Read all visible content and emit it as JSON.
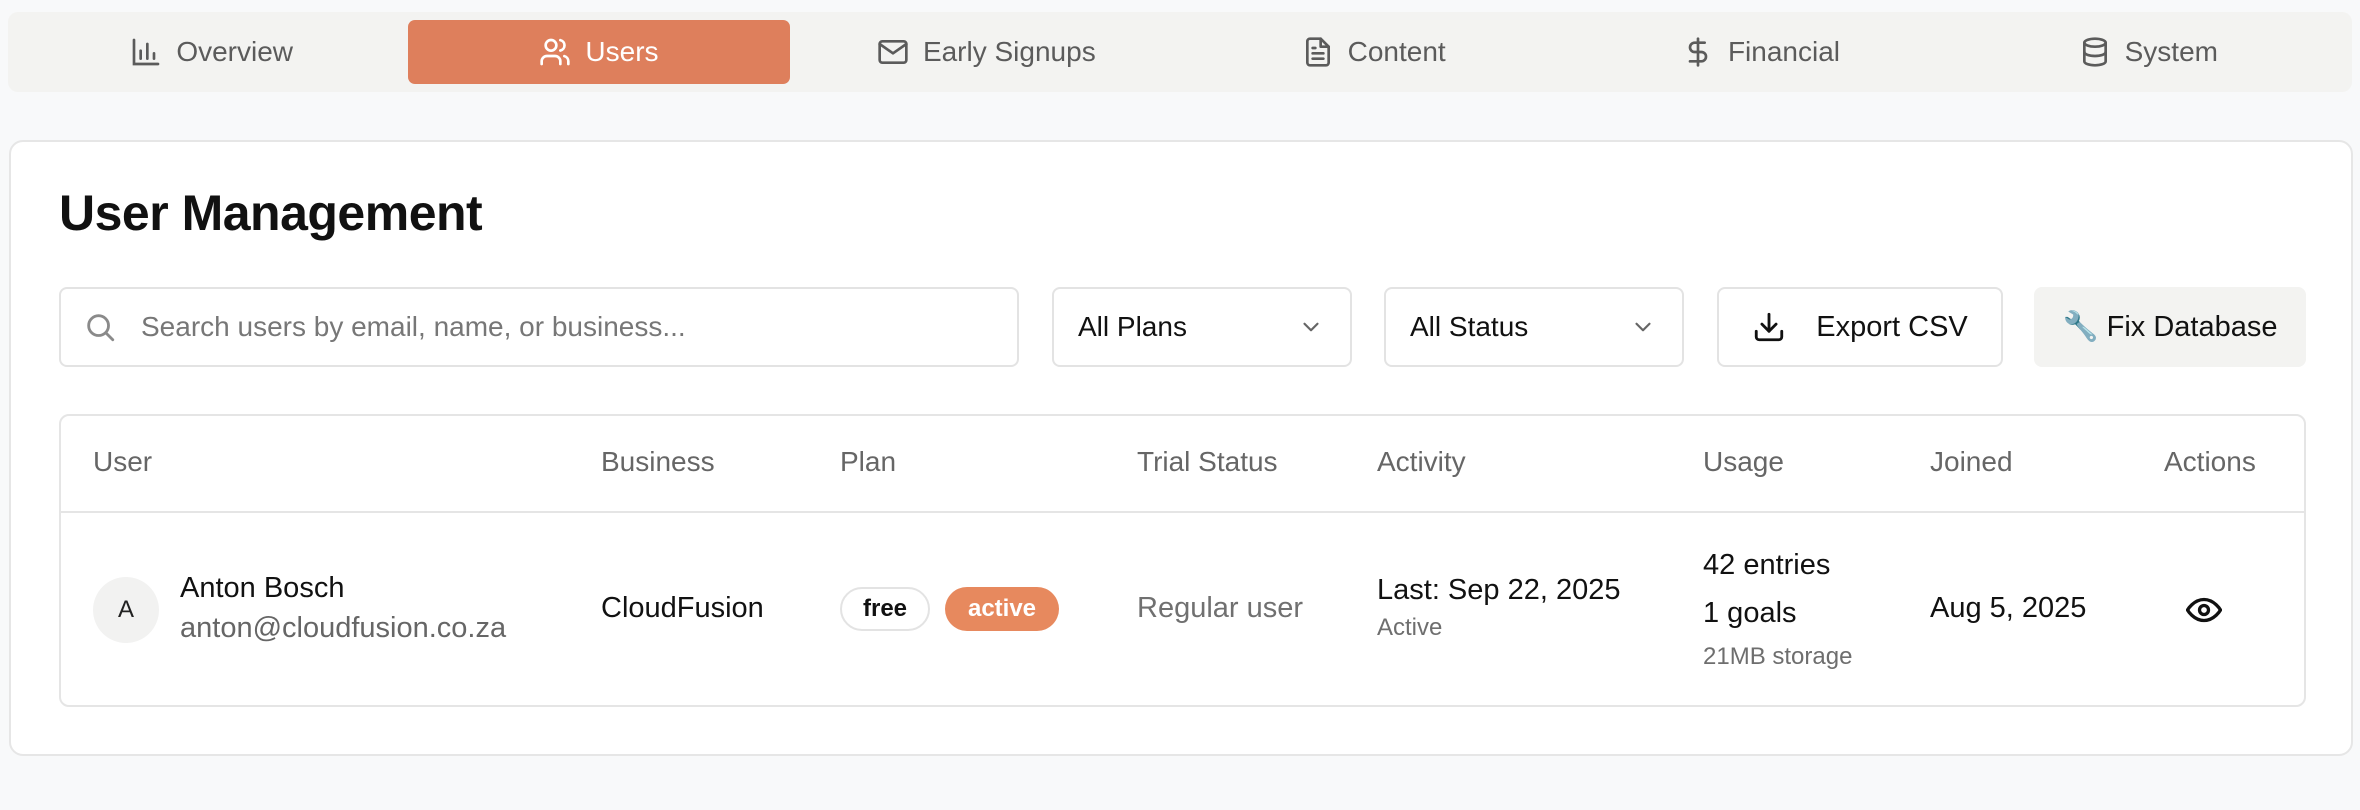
{
  "tabs": [
    {
      "label": "Overview",
      "icon": "bar-chart-icon",
      "active": false
    },
    {
      "label": "Users",
      "icon": "users-icon",
      "active": true
    },
    {
      "label": "Early Signups",
      "icon": "mail-icon",
      "active": false
    },
    {
      "label": "Content",
      "icon": "file-text-icon",
      "active": false
    },
    {
      "label": "Financial",
      "icon": "dollar-icon",
      "active": false
    },
    {
      "label": "System",
      "icon": "database-icon",
      "active": false
    }
  ],
  "colors": {
    "accent": "#de7f5c",
    "badge_active": "#e7895e"
  },
  "page": {
    "title": "User Management"
  },
  "search": {
    "placeholder": "Search users by email, name, or business...",
    "value": ""
  },
  "filters": {
    "plan": "All Plans",
    "status": "All Status"
  },
  "actions": {
    "export": "Export CSV",
    "fix_database": "🔧 Fix Database"
  },
  "table": {
    "columns": [
      "User",
      "Business",
      "Plan",
      "Trial Status",
      "Activity",
      "Usage",
      "Joined",
      "Actions"
    ],
    "rows": [
      {
        "avatar_initial": "A",
        "name": "Anton Bosch",
        "email": "anton@cloudfusion.co.za",
        "business": "CloudFusion",
        "plan": "free",
        "status": "active",
        "trial_status": "Regular user",
        "activity_last": "Last: Sep 22, 2025",
        "activity_state": "Active",
        "usage_entries": "42 entries",
        "usage_goals": "1 goals",
        "usage_storage": "21MB storage",
        "joined": "Aug 5, 2025",
        "action_icon": "eye-icon"
      }
    ]
  }
}
